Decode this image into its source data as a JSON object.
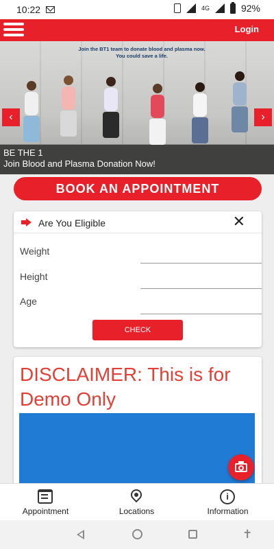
{
  "status_bar": {
    "time": "10:22",
    "network": "4G",
    "battery": "92%"
  },
  "header": {
    "login_label": "Login"
  },
  "hero": {
    "tagline": "Join the BT1 team to donate blood and plasma now. You could save a life.",
    "caption_line1": "BE THE 1",
    "caption_line2": "Join Blood and Plasma Donation Now!",
    "prev_label": "‹",
    "next_label": "›"
  },
  "book_button": {
    "label": "BOOK AN APPOINTMENT"
  },
  "eligibility": {
    "title": "Are You Eligible",
    "close_label": "✕",
    "fields": [
      {
        "label": "Weight",
        "value": ""
      },
      {
        "label": "Height",
        "value": ""
      },
      {
        "label": "Age",
        "value": ""
      }
    ],
    "check_label": "CHECK"
  },
  "disclaimer": {
    "text": "DISCLAIMER: This is for Demo Only"
  },
  "tabs": [
    {
      "label": "Appointment",
      "icon": "calendar-icon"
    },
    {
      "label": "Locations",
      "icon": "location-pin-icon"
    },
    {
      "label": "Information",
      "icon": "info-icon"
    }
  ],
  "colors": {
    "brand": "#e8202a",
    "disclaimer_text": "#e04035",
    "media_blue": "#1f7bd4"
  }
}
